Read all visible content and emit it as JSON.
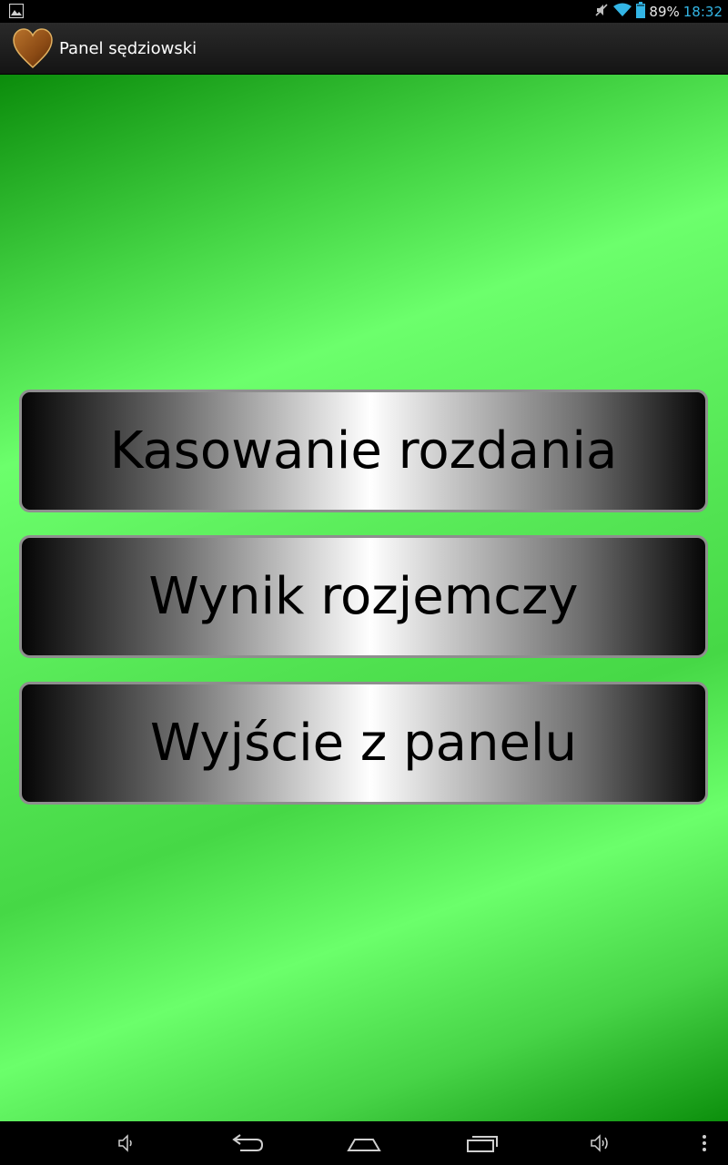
{
  "status_bar": {
    "battery_percent": "89%",
    "time": "18:32",
    "icons": [
      "gallery-notification-icon",
      "mute-icon",
      "wifi-icon",
      "battery-icon"
    ]
  },
  "action_bar": {
    "title": "Panel sędziowski",
    "icon": "heart-icon"
  },
  "main": {
    "buttons": [
      {
        "label": "Kasowanie rozdania"
      },
      {
        "label": "Wynik rozjemczy"
      },
      {
        "label": "Wyjście z panelu"
      }
    ]
  },
  "nav_bar": {
    "icons": [
      "volume-down-icon",
      "back-icon",
      "home-icon",
      "recents-icon",
      "volume-up-icon",
      "menu-icon"
    ]
  },
  "colors": {
    "accent_time": "#33b5e5",
    "background_green": "#6cff6c",
    "heart_brown": "#8b4513"
  }
}
